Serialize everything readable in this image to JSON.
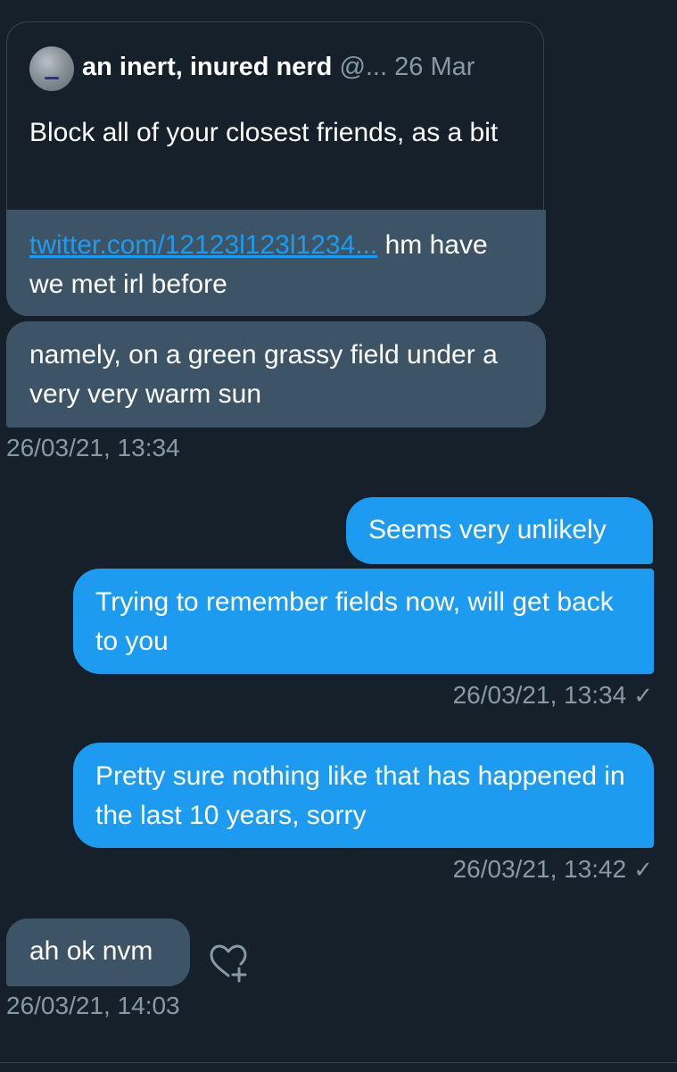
{
  "quote": {
    "author_name": "an inert, inured nerd",
    "author_handle": "@...",
    "date": "26 Mar",
    "text": "Block all of your closest friends, as a bit"
  },
  "messages": [
    {
      "direction": "received",
      "link": "twitter.com/12123l123l1234...",
      "text": " hm have we met irl before"
    },
    {
      "direction": "received",
      "text": "namely, on a green grassy field under a very very warm sun",
      "timestamp": "26/03/21, 13:34"
    },
    {
      "direction": "sent",
      "text": "Seems very unlikely"
    },
    {
      "direction": "sent",
      "text": "Trying to remember fields now, will get back to you",
      "timestamp": "26/03/21, 13:34",
      "status": "✓"
    },
    {
      "direction": "sent",
      "text": "Pretty sure nothing like that has happened in the last 10 years, sorry",
      "timestamp": "26/03/21, 13:42",
      "status": "✓"
    },
    {
      "direction": "received",
      "text": "ah ok nvm",
      "timestamp": "26/03/21, 14:03",
      "reaction_icon": "heart-plus-icon"
    }
  ],
  "colors": {
    "background": "#15202b",
    "received_bubble": "#3d5466",
    "sent_bubble": "#1d9bf0",
    "link": "#1d9bf0",
    "muted_text": "#8899a6"
  }
}
